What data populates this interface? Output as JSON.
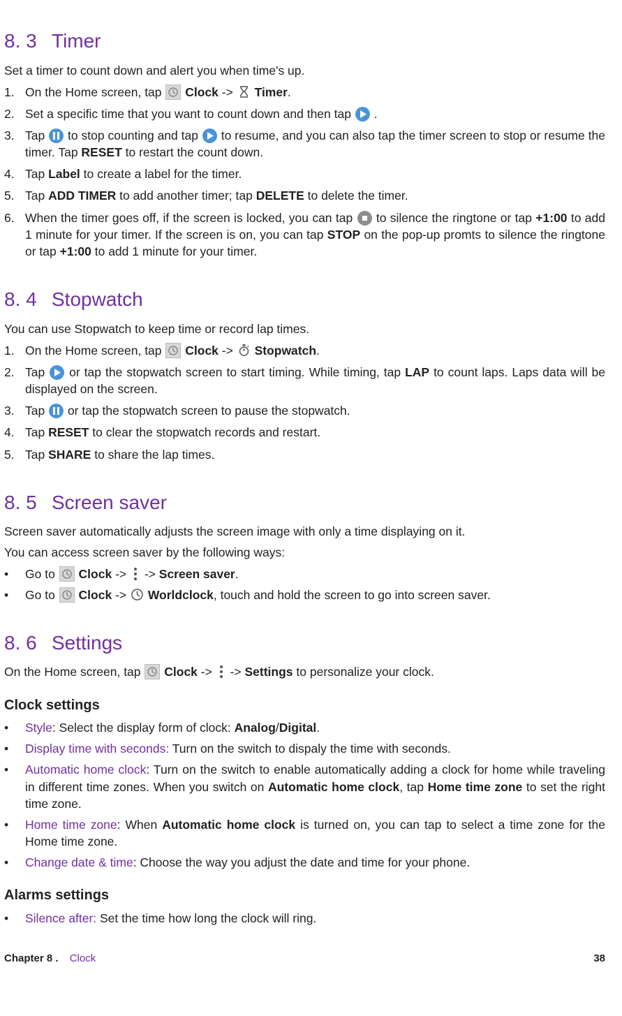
{
  "sections": {
    "s83": {
      "num": "8. 3",
      "title": "Timer"
    },
    "s84": {
      "num": "8. 4",
      "title": "Stopwatch"
    },
    "s85": {
      "num": "8. 5",
      "title": "Screen saver"
    },
    "s86": {
      "num": "8. 6",
      "title": "Settings"
    }
  },
  "timer": {
    "intro": "Set a timer to count down and alert you when time's up.",
    "step1a": "On the Home screen, tap ",
    "step1_clock": " Clock",
    "step1_arrow": " -> ",
    "step1_timer": " Timer",
    "step1_end": ".",
    "step2a": "Set a specific time that you want to count down and then tap ",
    "step2b": " .",
    "step3a": "Tap ",
    "step3b": " to stop counting and tap ",
    "step3c": " to resume, and you can also tap the timer screen to stop or resume the timer. Tap ",
    "step3_reset": "RESET",
    "step3d": " to restart the count down.",
    "step4a": "Tap ",
    "step4_label": "Label",
    "step4b": " to create a label for the timer.",
    "step5a": "Tap ",
    "step5_add": "ADD TIMER",
    "step5b": " to add another timer; tap ",
    "step5_del": "DELETE",
    "step5c": " to delete the timer.",
    "step6a": "When the timer goes off, if the screen is locked, you can tap ",
    "step6b": " to silence the ringtone or tap ",
    "step6_plus1": "+1:00",
    "step6c": " to add 1 minute for your timer. If the screen is on, you can tap ",
    "step6_stop": "STOP",
    "step6d": " on the pop-up promts to silence the ringtone or tap ",
    "step6_plus2": "+1:00",
    "step6e": " to add 1 minute for your timer."
  },
  "stopwatch": {
    "intro": "You can use Stopwatch to keep time or record lap times.",
    "step1a": "On the Home screen, tap ",
    "step1_clock": " Clock",
    "step1_arrow": " -> ",
    "step1_sw": " Stopwatch",
    "step1_end": ".",
    "step2a": "Tap ",
    "step2b": " or tap the stopwatch screen to start timing. While timing, tap ",
    "step2_lap": "LAP",
    "step2c": " to count laps. Laps data will be displayed on the screen.",
    "step3a": "Tap ",
    "step3b": " or tap the stopwatch screen to pause the stopwatch.",
    "step4a": "Tap ",
    "step4_reset": "RESET",
    "step4b": " to clear the stopwatch records and restart.",
    "step5a": "Tap ",
    "step5_share": "SHARE",
    "step5b": " to share the lap times."
  },
  "screensaver": {
    "intro1": "Screen saver automatically adjusts the screen image with only a time displaying on it.",
    "intro2": "You can access screen saver by the following ways:",
    "b1a": "Go to ",
    "b1_clock": " Clock",
    "b1_arrow1": " -> ",
    "b1_arrow2": " -> ",
    "b1_ss": "Screen saver",
    "b1_end": ".",
    "b2a": "Go to ",
    "b2_clock": " Clock",
    "b2_arrow": " -> ",
    "b2_wc": " Worldclock",
    "b2b": ", touch and hold the screen to go into screen saver."
  },
  "settings": {
    "intro_a": "On the Home screen, tap ",
    "intro_clock": " Clock",
    "intro_arrow1": " -> ",
    "intro_arrow2": " -> ",
    "intro_settings": "Settings",
    "intro_b": " to personalize your clock.",
    "clock_heading": "Clock settings",
    "style_label": "Style",
    "style_colon": ": Select the display form of clock: ",
    "style_analog": "Analog",
    "style_slash": "/",
    "style_digital": "Digital",
    "style_end": ".",
    "sec_label": "Display time with seconds:",
    "sec_text": " Turn on the switch to dispaly the time with seconds.",
    "auto_label": "Automatic home clock",
    "auto_a": ": Turn on the switch to enable automatically adding a clock for home while traveling in different time zones. When you switch on ",
    "auto_bold1": "Automatic home clock",
    "auto_b": ", tap ",
    "auto_bold2": "Home time zone",
    "auto_c": " to set the right time zone.",
    "home_label": "Home time zone",
    "home_a": ": When ",
    "home_bold": "Automatic home clock",
    "home_b": " is turned on, you can tap to select a time zone for the Home time zone.",
    "change_label": "Change date & time",
    "change_a": ": Choose the way you adjust the date and time for your phone.",
    "alarms_heading": "Alarms settings",
    "silence_label": "Silence after:",
    "silence_a": " Set the time how long the clock will ring."
  },
  "footer": {
    "chapter": "Chapter 8 .",
    "name": "Clock",
    "page": "38"
  }
}
